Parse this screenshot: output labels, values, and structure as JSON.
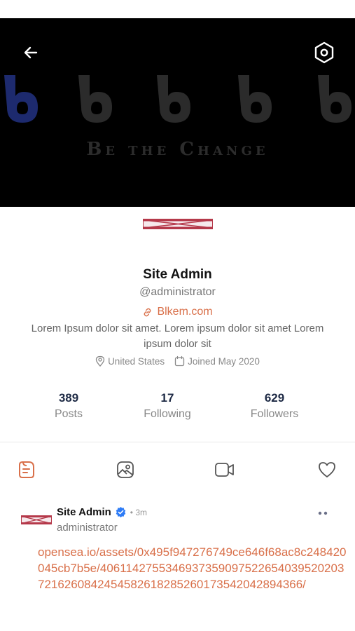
{
  "header": {
    "banner_slogan": "Be the Change",
    "back_icon": "arrow-left-icon",
    "settings_icon": "hexagon-settings-icon"
  },
  "profile": {
    "name": "Site Admin",
    "handle": "@administrator",
    "link": "Blkem.com",
    "bio": "Lorem Ipsum dolor sit amet. Lorem ipsum dolor sit amet Lorem ipsum dolor sit",
    "location": "United States",
    "joined": "Joined May 2020"
  },
  "stats": [
    {
      "value": "389",
      "label": "Posts"
    },
    {
      "value": "17",
      "label": "Following"
    },
    {
      "value": "629",
      "label": "Followers"
    }
  ],
  "tabs": [
    {
      "icon": "posts-icon",
      "active": true
    },
    {
      "icon": "photos-icon",
      "active": false
    },
    {
      "icon": "videos-icon",
      "active": false
    },
    {
      "icon": "likes-icon",
      "active": false
    }
  ],
  "post": {
    "author": "Site Admin",
    "time": "• 3m",
    "username": "administrator",
    "body": "opensea.io/assets/0x495f947276749ce646f68ac8c248420045cb7b5e/40611427553469373590975226540395202037216260842454582618285260173542042894366/"
  },
  "colors": {
    "accent": "#d9704a",
    "stat_number": "#1e2a45",
    "verified": "#2e7cf6",
    "avatar_red": "#b5394a"
  }
}
